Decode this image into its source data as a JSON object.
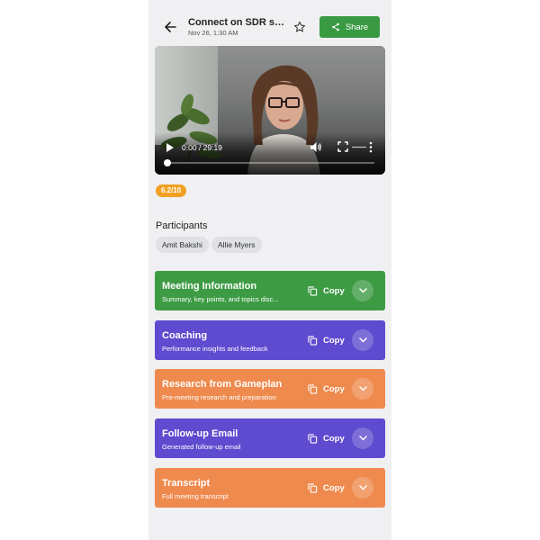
{
  "header": {
    "title": "Connect on SDR su...",
    "subtitle": "Nov 26, 1:30 AM",
    "share_label": "Share"
  },
  "video": {
    "time": "0:00 / 29:19",
    "progress_fraction": 0
  },
  "score": "6.2/10",
  "participants": {
    "heading": "Participants",
    "people": [
      "Amit Bakshi",
      "Allie Myers"
    ]
  },
  "sections": [
    {
      "title": "Meeting Information",
      "subtitle": "Summary, key points, and topics disc...",
      "copy_label": "Copy",
      "color": "#3d9b44"
    },
    {
      "title": "Coaching",
      "subtitle": "Performance insights and feedback",
      "copy_label": "Copy",
      "color": "#5e4bcf"
    },
    {
      "title": "Research from Gameplan",
      "subtitle": "Pre-meeting research and preparation",
      "copy_label": "Copy",
      "color": "#ef8a4e"
    },
    {
      "title": "Follow-up Email",
      "subtitle": "Generated follow-up email",
      "copy_label": "Copy",
      "color": "#5e4bcf"
    },
    {
      "title": "Transcript",
      "subtitle": "Full meeting transcript",
      "copy_label": "Copy",
      "color": "#ef8a4e"
    }
  ],
  "colors": {
    "share_green": "#3a9a43",
    "score_orange": "#f2a023",
    "background": "#f0f0f2"
  },
  "icons": {
    "back": "arrow-left-icon",
    "star": "star-icon",
    "share": "share-icon",
    "copy": "copy-icon",
    "expand": "chevron-down-icon"
  }
}
